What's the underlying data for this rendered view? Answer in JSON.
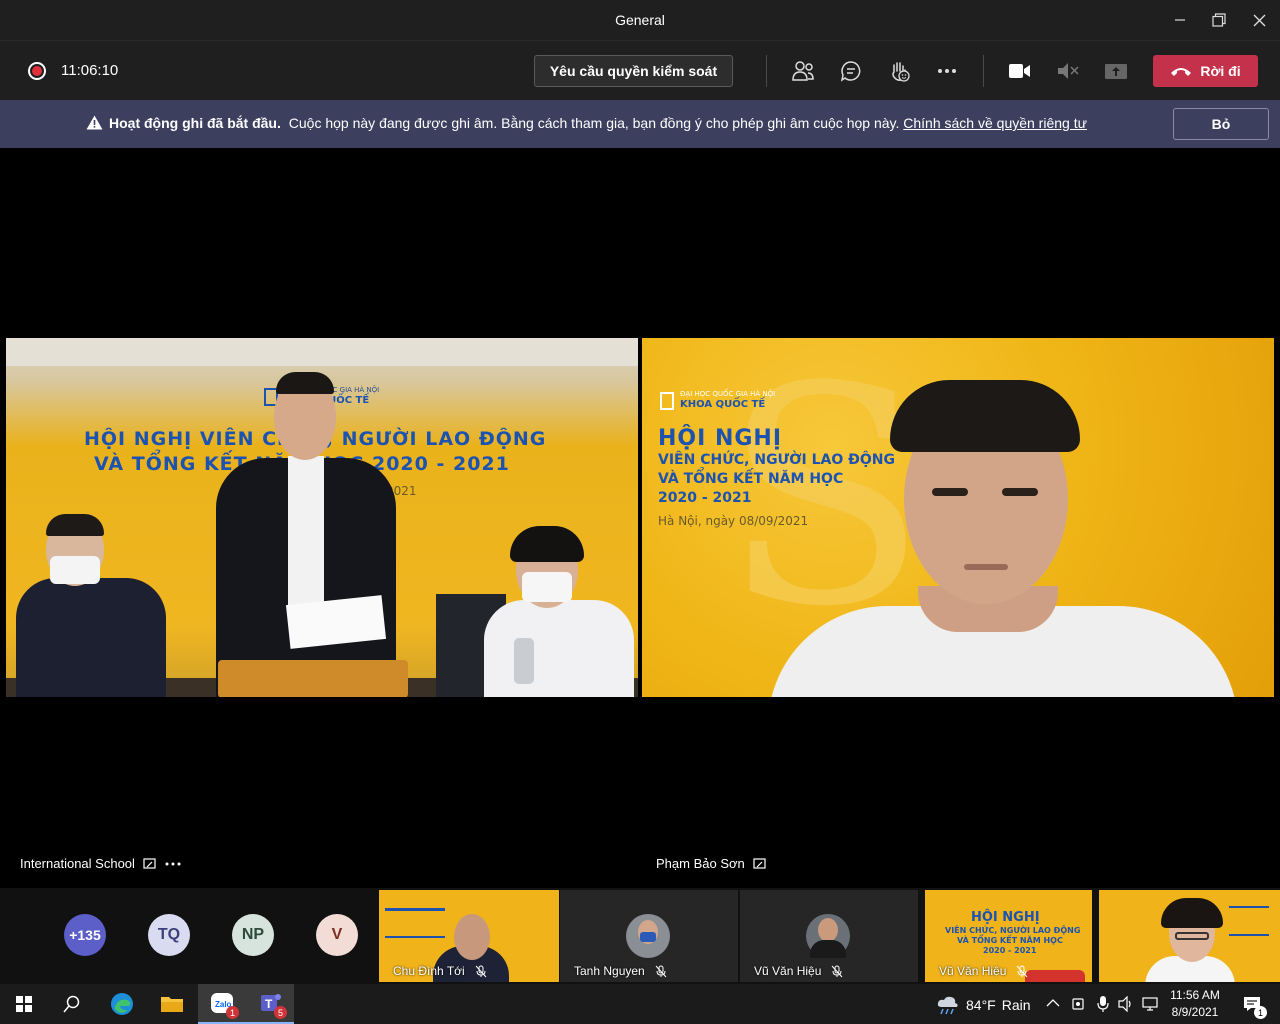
{
  "window": {
    "title": "General"
  },
  "toolbar": {
    "timer": "11:06:10",
    "request_control_label": "Yêu cầu quyền kiểm soát",
    "leave_label": "Rời đi"
  },
  "banner": {
    "bold_text": "Hoạt động ghi đã bắt đầu.",
    "message": "Cuộc họp này đang được ghi âm. Bằng cách tham gia, bạn đồng ý cho phép ghi âm cuộc họp này.",
    "link_text": "Chính sách về quyền riêng tư",
    "dismiss_label": "Bỏ"
  },
  "main_tiles": [
    {
      "name": "International School",
      "backdrop": {
        "logo_text": "KHOA QUỐC TẾ",
        "logo_sub": "ĐẠI HỌC QUỐC GIA HÀ NỘI",
        "line1": "HỘI NGHỊ VIÊN CHỨC, NGƯỜI LAO ĐỘNG",
        "line2": "VÀ TỔNG KẾT NĂM HỌC 2020 - 2021",
        "date_fragment": "2021"
      }
    },
    {
      "name": "Phạm Bảo Sơn",
      "backdrop": {
        "logo_text": "KHOA QUỐC TẾ",
        "logo_sub": "ĐẠI HỌC QUỐC GIA HÀ NỘI",
        "heading": "HỘI NGHỊ",
        "line1": "VIÊN CHỨC, NGƯỜI LAO ĐỘNG",
        "line2": "VÀ TỔNG KẾT NĂM HỌC",
        "line3": "2020 - 2021",
        "date": "Hà Nội, ngày 08/09/2021"
      }
    }
  ],
  "participants": {
    "overflow": "+135",
    "avatars": [
      "TQ",
      "NP",
      "V"
    ],
    "thumbnails": [
      {
        "name": "Chu Đình Tới"
      },
      {
        "name": "Tanh Nguyen"
      },
      {
        "name": "Vũ Văn Hiệu"
      },
      {
        "name": "Vũ Văn Hiệu",
        "backdrop_heading": "HỘI NGHỊ",
        "backdrop_line1": "VIÊN CHỨC, NGƯỜI LAO ĐỘNG",
        "backdrop_line2": "VÀ TỔNG KẾT NĂM HỌC",
        "backdrop_line3": "2020 - 2021"
      },
      {
        "name": ""
      }
    ]
  },
  "taskbar": {
    "weather_temp": "84°F",
    "weather_text": "Rain",
    "time": "11:56 AM",
    "date": "8/9/2021",
    "zalo_badge": "1",
    "teams_badge": "5",
    "notification_badge": "1"
  },
  "colors": {
    "leave": "#c4314b",
    "banner": "#3d3f5e",
    "record": "#e02f3c",
    "backdrop_yellow": "#f0b617"
  }
}
